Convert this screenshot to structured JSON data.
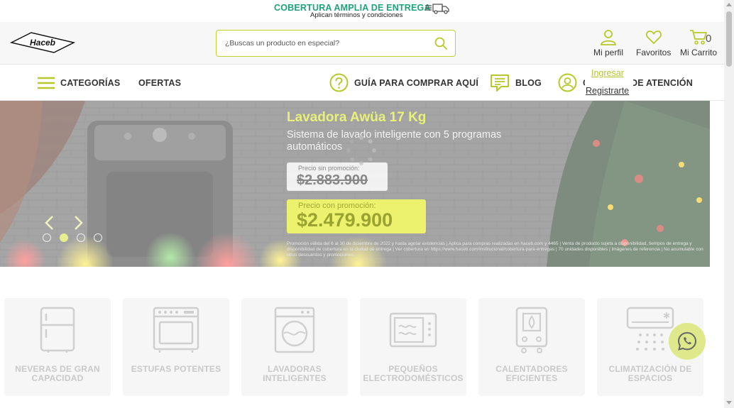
{
  "promo": {
    "title": "COBERTURA AMPLIA DE ENTREGA",
    "subtitle": "Aplican términos y condiciones",
    "icon": "delivery-truck-icon"
  },
  "header": {
    "logo_text": "Haceb",
    "search_placeholder": "¿Buscas un producto en especial?",
    "profile_label": "Mi perfil",
    "favorites_label": "Favoritos",
    "cart_label": "Mi Carrito",
    "cart_count": "0"
  },
  "nav": {
    "categories": "CATEGORÍAS",
    "offers": "OFERTAS",
    "guide": "GUÍA PARA COMPRAR AQUÍ",
    "blog": "BLOG",
    "attention_visible": "C",
    "attention_visible_tail": "DE ATENCIÓN"
  },
  "account_menu": {
    "login": "Ingresar",
    "register": "Registrarte"
  },
  "banner": {
    "title": "Lavadora Awüa 17 Kg",
    "subtitle": "Sistema de lavado inteligente con 5 programas automáticos",
    "price_before_label": "Precio sin promoción:",
    "price_before": "$2.883.900",
    "price_after_label": "Precio con promoción:",
    "price_after": "$2.479.900",
    "legal": "Promoción válida del 6 al 30 de diciembre de 2022 y hasta agotar existencias | Aplica para compras realizadas en haceb.com y 4465 | Venta de producto sujeta a disponibilidad, tiempos de entrega y disponibilidad de cobertura en la ciudad de entrega | Ver cobertura en https://www.haceb.com/institucional/cobertura-para-entregas | 70 unidades disponibles | Imágenes de referencia | No acumulable con otros descuentos y promociones.",
    "active_slide": 2,
    "slide_count": 4
  },
  "categories": [
    {
      "label": "NEVERAS DE GRAN CAPACIDAD",
      "icon": "fridge-icon"
    },
    {
      "label": "ESTUFAS POTENTES",
      "icon": "stove-icon"
    },
    {
      "label": "LAVADORAS INTELIGENTES",
      "icon": "washer-icon"
    },
    {
      "label": "PEQUEÑOS ELECTRODOMÉSTICOS",
      "icon": "microwave-icon"
    },
    {
      "label": "CALENTADORES EFICIENTES",
      "icon": "water-heater-icon"
    },
    {
      "label": "CLIMATIZACIÓN DE ESPACIOS",
      "icon": "air-conditioner-icon"
    }
  ],
  "colors": {
    "brand_green": "#1fa37a",
    "accent_lime": "#b8c82a",
    "link_lime": "#b6c530"
  },
  "whatsapp_icon": "whatsapp-icon"
}
